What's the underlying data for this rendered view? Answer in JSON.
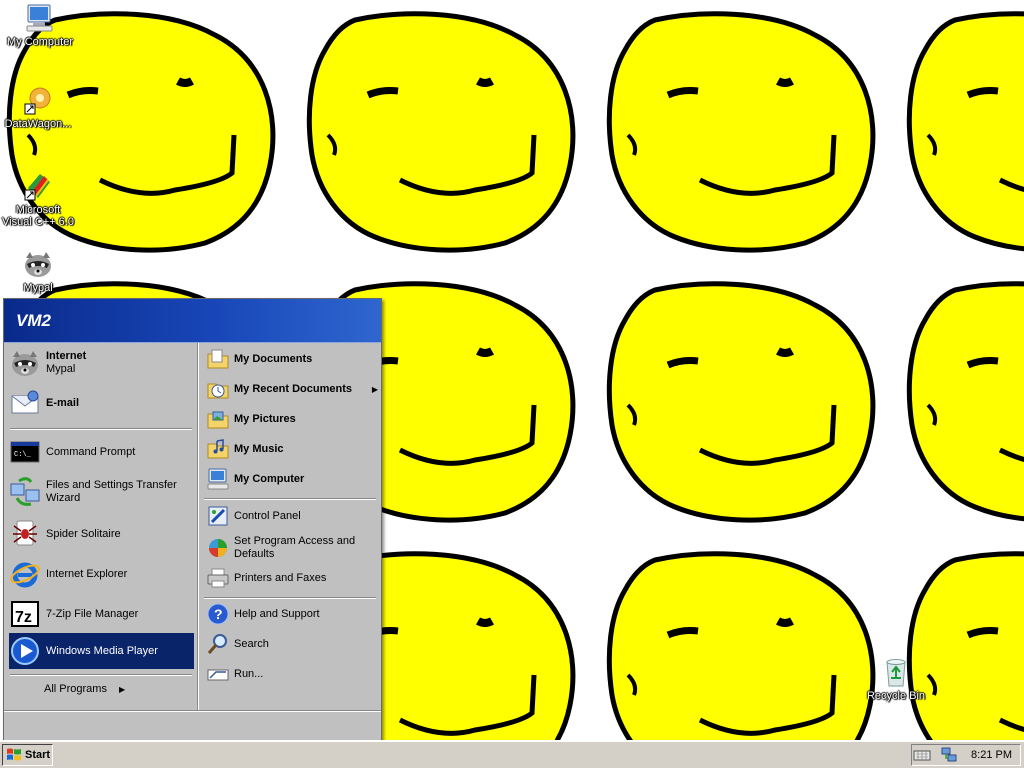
{
  "desktop": {
    "icons": [
      {
        "label": "My Computer",
        "icon": "computer-icon"
      },
      {
        "label": "DataWagon...",
        "icon": "datawagon-icon"
      },
      {
        "label": "Microsoft Visual C++ 6.0",
        "icon": "visual-cpp-icon"
      },
      {
        "label": "Mypal",
        "icon": "mypal-raccoon-icon"
      },
      {
        "label": "Recycle Bin",
        "icon": "recycle-bin-icon"
      }
    ],
    "wallpaper": {
      "face_color": "#ffff00",
      "outline_color": "#000000",
      "background": "#ffffff"
    }
  },
  "start_menu": {
    "user_name": "VM2",
    "pinned": [
      {
        "title": "Internet",
        "subtitle": "Mypal",
        "icon": "mypal-icon"
      },
      {
        "title": "E-mail",
        "icon": "email-icon"
      }
    ],
    "recent": [
      {
        "label": "Command Prompt",
        "icon": "command-prompt-icon"
      },
      {
        "label": "Files and Settings Transfer Wizard",
        "icon": "transfer-wizard-icon"
      },
      {
        "label": "Spider Solitaire",
        "icon": "spider-solitaire-icon"
      },
      {
        "label": "Internet Explorer",
        "icon": "internet-explorer-icon"
      },
      {
        "label": "7-Zip File Manager",
        "icon": "seven-zip-icon"
      },
      {
        "label": "Windows Media Player",
        "icon": "media-player-icon",
        "selected": true
      }
    ],
    "all_programs": "All Programs",
    "places": [
      {
        "label": "My Documents",
        "icon": "my-documents-icon"
      },
      {
        "label": "My Recent Documents",
        "icon": "recent-documents-icon",
        "submenu": true
      },
      {
        "label": "My Pictures",
        "icon": "my-pictures-icon"
      },
      {
        "label": "My Music",
        "icon": "my-music-icon"
      },
      {
        "label": "My Computer",
        "icon": "my-computer-icon"
      }
    ],
    "settings": [
      {
        "label": "Control Panel",
        "icon": "control-panel-icon"
      },
      {
        "label": "Set Program Access and Defaults",
        "icon": "program-access-icon"
      },
      {
        "label": "Printers and Faxes",
        "icon": "printers-icon"
      }
    ],
    "help": [
      {
        "label": "Help and Support",
        "icon": "help-icon"
      },
      {
        "label": "Search",
        "icon": "search-icon"
      },
      {
        "label": "Run...",
        "icon": "run-icon"
      }
    ],
    "selected_color": "#0a246a",
    "header_color": "#1846b8"
  },
  "taskbar": {
    "start_label": "Start",
    "clock": "8:21 PM",
    "tray_icons": [
      "keyboard-icon",
      "network-icon"
    ]
  }
}
